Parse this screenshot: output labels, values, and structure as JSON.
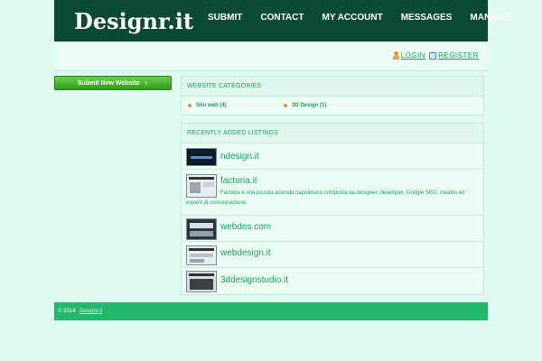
{
  "header": {
    "logo": "Designr.it",
    "nav": [
      "SUBMIT",
      "CONTACT",
      "MY ACCOUNT",
      "MESSAGES",
      "MANAGE"
    ]
  },
  "auth": {
    "login": "LOGIN",
    "register": "REGISTER"
  },
  "sidebar": {
    "submit_label": "Submit New Website",
    "submit_icon": "up-arrow-icon"
  },
  "categories": {
    "heading": "WEBSITE CATEGORIES",
    "items": [
      "Sito web (4)",
      "3D Design (1)"
    ]
  },
  "recent": {
    "heading": "RECENTLY ADDED LISTINGS",
    "items": [
      {
        "title": "ndesign.it",
        "desc": ""
      },
      {
        "title": "factoria.it",
        "desc": "Factoria è una piccola azienda napoletana composta da designer, developer, Google SEO, creativi ed esperti di comunicazione."
      },
      {
        "title": "webdes.com",
        "desc": ""
      },
      {
        "title": "webdesign.it",
        "desc": ""
      },
      {
        "title": "3ddesignstudio.it",
        "desc": ""
      }
    ]
  },
  "footer": {
    "copyright": "© 2014",
    "link": "Designr.it"
  },
  "colors": {
    "header_bg": "#0b4a36",
    "accent": "#1b9c5c",
    "footer_bg": "#22b76b",
    "page_bg": "#dffaf0"
  }
}
